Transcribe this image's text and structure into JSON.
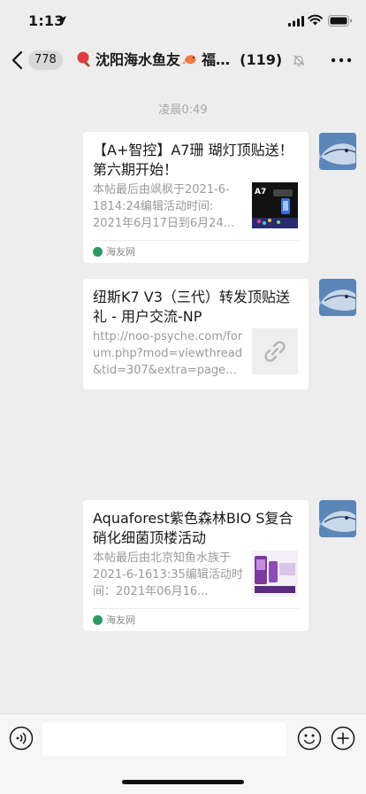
{
  "status_bar": {
    "time": "1:13"
  },
  "nav": {
    "unread_count": "778",
    "title": "沈阳海水鱼友",
    "title_after": "福…",
    "member_count": "(119)"
  },
  "chat": {
    "timestamp": "凌晨0:49",
    "messages": [
      {
        "title": "【A+智控】A7珊 瑚灯顶贴送！第六期开始！",
        "desc": "本帖最后由飒枫于2021-6-1814:24编辑活动时间: 2021年6月17日到6月24...",
        "source": "海友网",
        "thumb_label": "A7"
      },
      {
        "title": "纽斯K7 V3（三代）转发顶贴送礼 - 用户交流-NP",
        "desc": "http://noo-psyche.com/forum.php?mod=viewthread&tid=307&extra=page..."
      },
      {
        "title": "Aquaforest紫色森林BIO S复合硝化细菌顶楼活动",
        "desc": "本帖最后由北京知鱼水族于2021-6-1613:35编辑活动时间：2021年06月16...",
        "source": "海友网"
      }
    ]
  },
  "colors": {
    "chat_background": "#ededed",
    "card_background": "#ffffff",
    "source_icon": "#2e9b62",
    "avatar": "#5b86b8"
  }
}
